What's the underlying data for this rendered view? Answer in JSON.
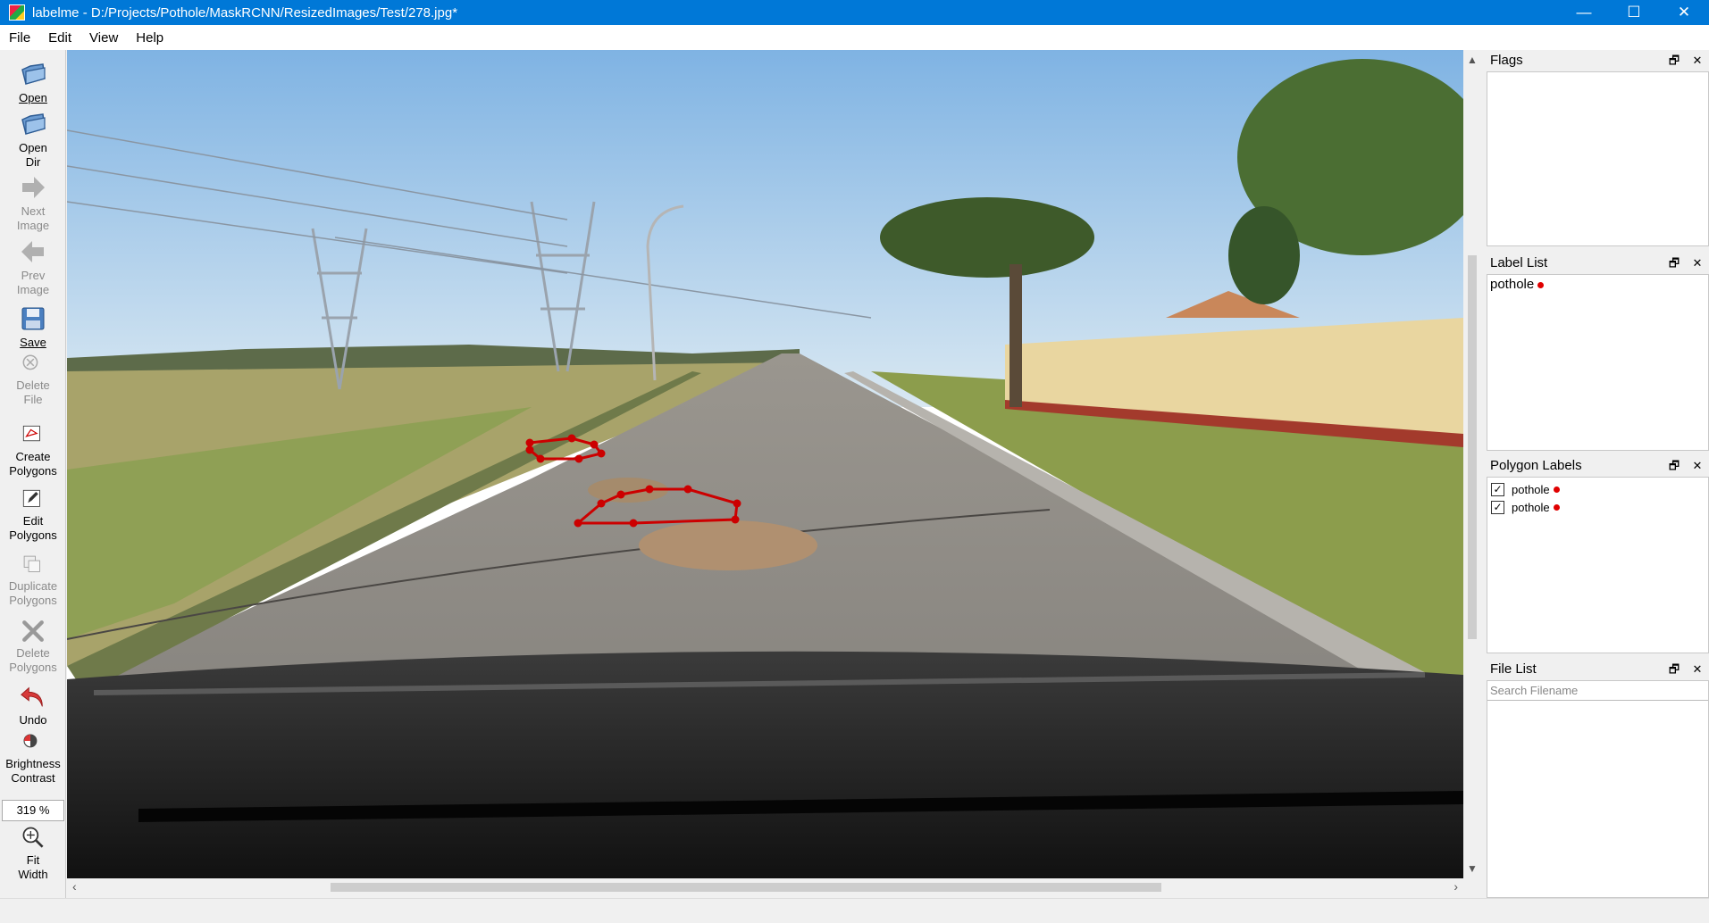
{
  "window": {
    "title": "labelme - D:/Projects/Pothole/MaskRCNN/ResizedImages/Test/278.jpg*",
    "minimize": "—",
    "maximize": "☐",
    "close": "✕"
  },
  "menu": [
    "File",
    "Edit",
    "View",
    "Help"
  ],
  "tools": {
    "open": {
      "l1": "Open",
      "l2": ""
    },
    "open_dir": {
      "l1": "Open",
      "l2": "Dir"
    },
    "next_image": {
      "l1": "Next",
      "l2": "Image"
    },
    "prev_image": {
      "l1": "Prev",
      "l2": "Image"
    },
    "save": {
      "l1": "Save",
      "l2": ""
    },
    "delete_file": {
      "l1": "Delete",
      "l2": "File"
    },
    "create_polygons": {
      "l1": "Create",
      "l2": "Polygons"
    },
    "edit_polygons": {
      "l1": "Edit",
      "l2": "Polygons"
    },
    "duplicate_polygons": {
      "l1": "Duplicate",
      "l2": "Polygons"
    },
    "delete_polygons": {
      "l1": "Delete",
      "l2": "Polygons"
    },
    "undo": {
      "l1": "Undo",
      "l2": ""
    },
    "brightness_contrast": {
      "l1": "Brightness",
      "l2": "Contrast"
    },
    "zoom": "319 %",
    "fit_width": {
      "l1": "Fit",
      "l2": "Width"
    }
  },
  "docks": {
    "flags": {
      "title": "Flags"
    },
    "label_list": {
      "title": "Label List",
      "items": [
        "pothole"
      ]
    },
    "polygon_labels": {
      "title": "Polygon Labels",
      "items": [
        "pothole",
        "pothole"
      ]
    },
    "file_list": {
      "title": "File List",
      "search_placeholder": "Search Filename"
    }
  },
  "colors": {
    "titlebar": "#0078d7",
    "label_dot": "#e00000",
    "polygon": "#cc0000"
  }
}
